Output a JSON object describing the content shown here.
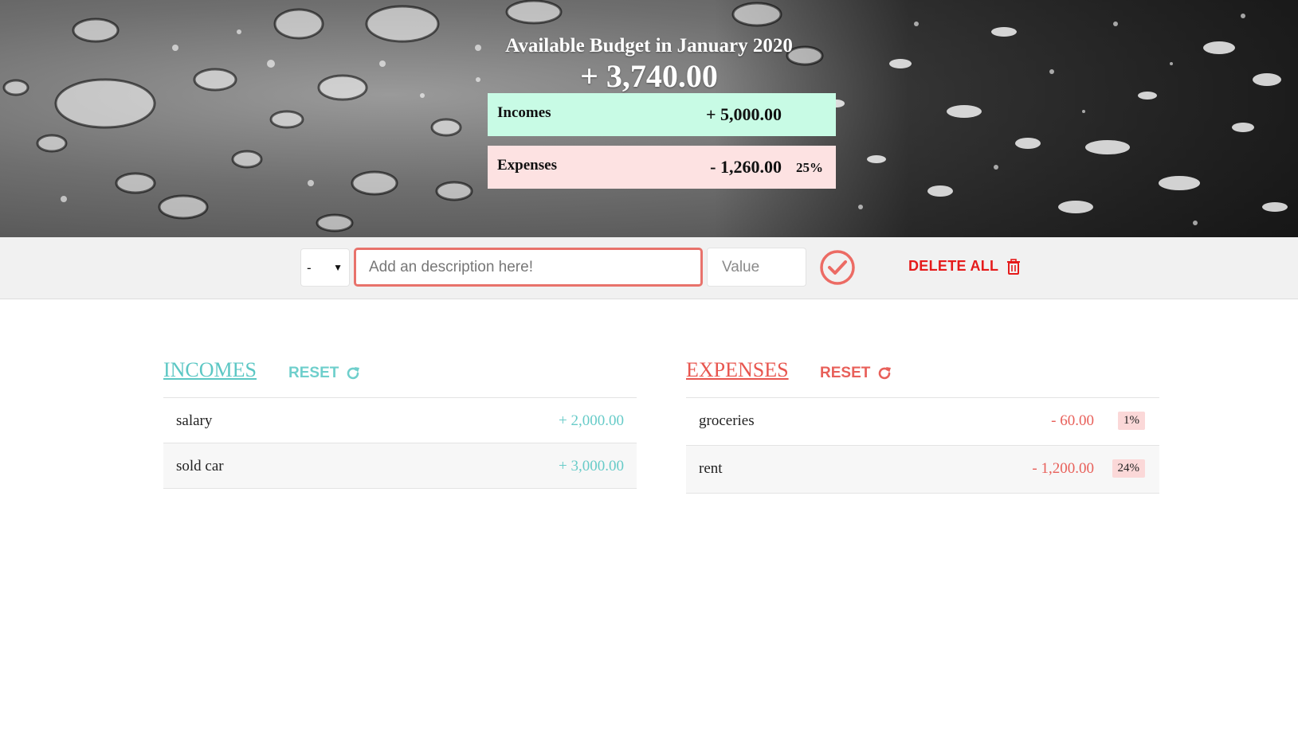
{
  "header": {
    "title": "Available Budget in January 2020",
    "budget": "+ 3,740.00",
    "incomes": {
      "label": "Incomes",
      "value": "+ 5,000.00"
    },
    "expenses": {
      "label": "Expenses",
      "value": "- 1,260.00",
      "percent": "25%"
    }
  },
  "input_bar": {
    "type_value": "-",
    "description_placeholder": "Add an description here!",
    "value_placeholder": "Value",
    "delete_all_label": "DELETE ALL"
  },
  "incomes": {
    "title": "INCOMES",
    "reset_label": "RESET",
    "items": [
      {
        "description": "salary",
        "value": "+ 2,000.00"
      },
      {
        "description": "sold car",
        "value": "+ 3,000.00"
      }
    ]
  },
  "expenses": {
    "title": "EXPENSES",
    "reset_label": "RESET",
    "items": [
      {
        "description": "groceries",
        "value": "- 60.00",
        "percent": "1%"
      },
      {
        "description": "rent",
        "value": "- 1,200.00",
        "percent": "24%"
      }
    ]
  },
  "colors": {
    "income_accent": "#5cc7c4",
    "expense_accent": "#e8564f",
    "delete_red": "#e51b1b",
    "income_box": "#c8fbe5",
    "expense_box": "#fde2e2"
  },
  "icons": {
    "add": "check-circle-icon",
    "delete_all": "trash-icon",
    "reset": "refresh-icon"
  }
}
